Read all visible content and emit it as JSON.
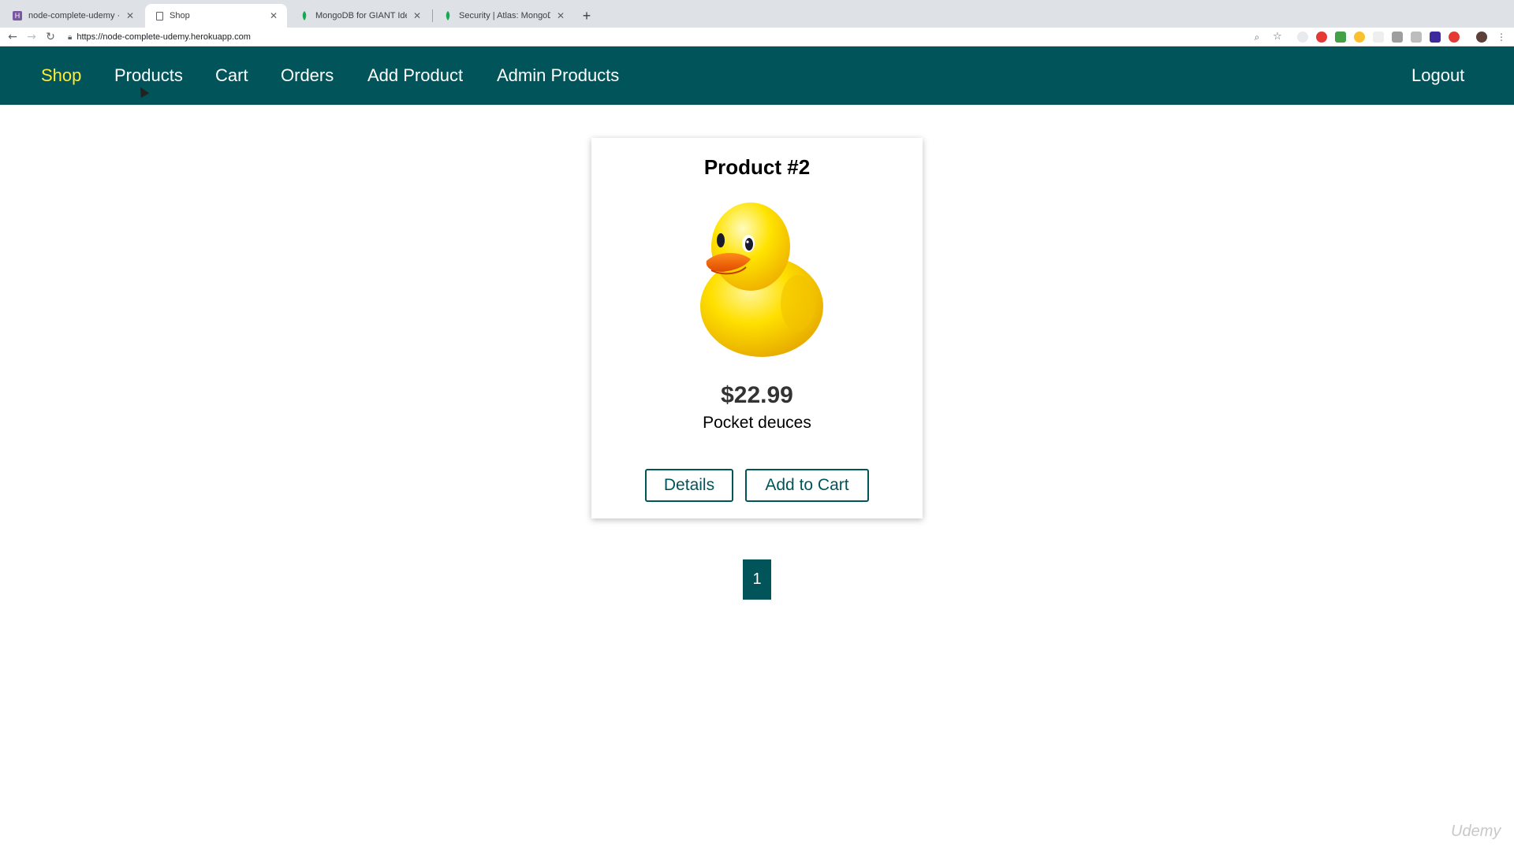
{
  "browser": {
    "tabs": [
      {
        "title": "node-complete-udemy · Reso",
        "favicon": "heroku-icon",
        "favicon_color": "#79589f",
        "active": false
      },
      {
        "title": "Shop",
        "favicon": "page-icon",
        "favicon_color": "#ffffff",
        "active": true
      },
      {
        "title": "MongoDB for GIANT Ideas | M",
        "favicon": "mongodb-leaf-icon",
        "favicon_color": "#13aa52",
        "active": false
      },
      {
        "title": "Security | Atlas: MongoDB Atl",
        "favicon": "mongodb-leaf-icon",
        "favicon_color": "#13aa52",
        "active": false
      }
    ],
    "new_tab_label": "+",
    "url": "https://node-complete-udemy.herokuapp.com"
  },
  "navbar": {
    "background": "#00545a",
    "active_color": "#ffeb3b",
    "items": [
      {
        "label": "Shop",
        "active": true
      },
      {
        "label": "Products",
        "active": false
      },
      {
        "label": "Cart",
        "active": false
      },
      {
        "label": "Orders",
        "active": false
      },
      {
        "label": "Add Product",
        "active": false
      },
      {
        "label": "Admin Products",
        "active": false
      }
    ],
    "logout_label": "Logout"
  },
  "product": {
    "title": "Product #2",
    "image": "rubber-duck-image",
    "price": "$22.99",
    "description": "Pocket deuces",
    "details_label": "Details",
    "add_to_cart_label": "Add to Cart"
  },
  "pagination": {
    "current_page": "1"
  },
  "watermark": "Udemy"
}
